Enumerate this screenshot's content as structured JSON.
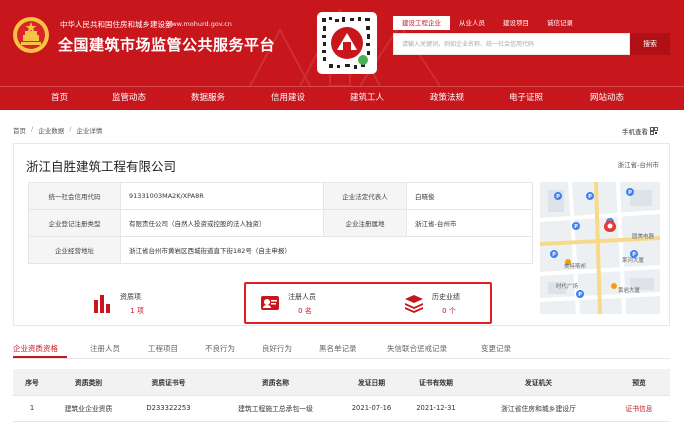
{
  "header": {
    "org": "中华人民共和国住房和城乡建设部",
    "url": "www.mohurd.gov.cn",
    "title": "全国建筑市场监管公共服务平台",
    "search_tabs": [
      "建设工程企业",
      "从业人员",
      "建设项目",
      "诚信记录"
    ],
    "search_placeholder": "请输入关键词，例如企业名称、统一社会信用代码",
    "search_button": "搜索",
    "brand_color": "#c8161d"
  },
  "nav": [
    "首页",
    "监管动态",
    "数据服务",
    "信用建设",
    "建筑工人",
    "政策法规",
    "电子证照",
    "网站动态"
  ],
  "breadcrumb": [
    "首页",
    "企业数据",
    "企业详情"
  ],
  "mobile_view": "手机查看",
  "company": {
    "name": "浙江自胜建筑工程有限公司",
    "region": "浙江省-台州市",
    "labels": {
      "credit_code": "统一社会信用代码",
      "legal_rep": "企业法定代表人",
      "reg_type": "企业登记注册类型",
      "reg_place": "企业注册属地",
      "address": "企业经营地址"
    },
    "credit_code": "91331003MA2K/XPA8R",
    "legal_rep": "白晓俊",
    "reg_type": "有限责任公司（自然人投资或控股的法人独资）",
    "reg_place": "浙江省-台州市",
    "address": "浙江省台州市黄岩区西城街道直下街182号（自主申报）"
  },
  "map_labels": {
    "l1": "圆美电器",
    "l2": "莱河大厦",
    "l3": "美特斯邦",
    "l4": "时代广场",
    "l5": "黄岩大厦"
  },
  "stats": [
    {
      "label": "资质项",
      "count": "1 项",
      "icon": "certificate-icon"
    },
    {
      "label": "注册人员",
      "count": "0 名",
      "icon": "registered-person-icon"
    },
    {
      "label": "历史业绩",
      "count": "0 个",
      "icon": "history-stack-icon"
    }
  ],
  "tabs": [
    "企业资质资格",
    "注册人员",
    "工程项目",
    "不良行为",
    "良好行为",
    "黑名单记录",
    "失信联合惩戒记录",
    "变更记录"
  ],
  "table": {
    "headers": [
      "序号",
      "资质类别",
      "资质证书号",
      "资质名称",
      "发证日期",
      "证书有效期",
      "发证机关",
      "预览"
    ],
    "rows": [
      [
        "1",
        "建筑业企业资质",
        "D233322253",
        "建筑工程施工总承包一级",
        "2021-07-16",
        "2021-12-31",
        "浙江省住房和城乡建设厅",
        "证书信息"
      ]
    ]
  }
}
